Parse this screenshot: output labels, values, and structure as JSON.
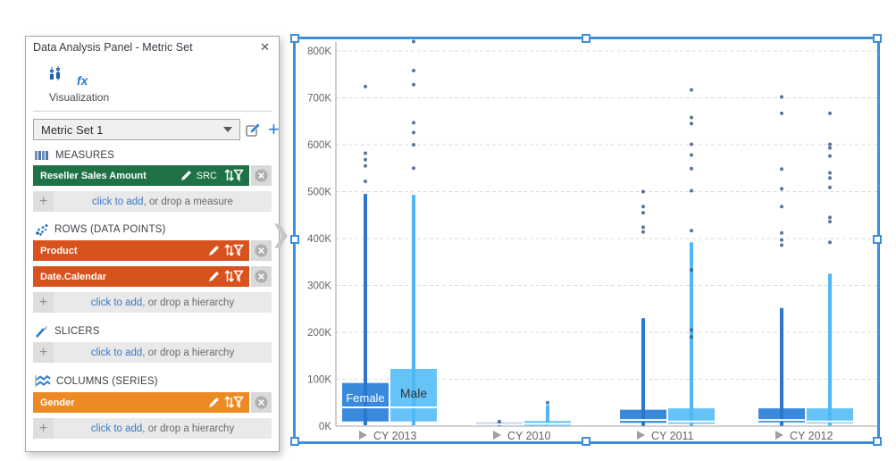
{
  "panel": {
    "title": "Data Analysis Panel - Metric Set",
    "visualization_label": "Visualization",
    "metric_set": {
      "selected": "Metric Set 1"
    },
    "sections": {
      "measures": {
        "label": "MEASURES",
        "items": [
          {
            "label": "Reseller Sales Amount",
            "badge": "SRC",
            "color": "#1E7245"
          }
        ],
        "add_link": "click to add",
        "add_rest": ", or drop a measure"
      },
      "rows": {
        "label": "ROWS (DATA POINTS)",
        "items": [
          {
            "label": "Product",
            "color": "#D8521D"
          },
          {
            "label": "Date.Calendar",
            "color": "#D8521D"
          }
        ],
        "add_link": "click to add",
        "add_rest": ", or drop a hierarchy"
      },
      "slicers": {
        "label": "SLICERS",
        "items": [],
        "add_link": "click to add",
        "add_rest": ", or drop a hierarchy"
      },
      "columns": {
        "label": "COLUMNS (SERIES)",
        "items": [
          {
            "label": "Gender",
            "color": "#EE8A24"
          }
        ],
        "add_link": "click to add",
        "add_rest": ", or drop a hierarchy"
      }
    }
  },
  "colors": {
    "selection": "#3E8EDE",
    "measure_green": "#1E7245",
    "row_orange_red": "#D8521D",
    "column_orange": "#EE8A24",
    "link_blue": "#3B78C8",
    "accent_blue": "#2B7CD3"
  },
  "chart_data": {
    "type": "boxplot",
    "title": "",
    "value_unit": "thousands (K)",
    "y_axis": {
      "min": 0,
      "max": 800,
      "tick_step": 100,
      "tick_labels": [
        "0K",
        "100K",
        "200K",
        "300K",
        "400K",
        "500K",
        "600K",
        "700K",
        "800K"
      ]
    },
    "categories": [
      "CY 2013",
      "CY 2010",
      "CY 2011",
      "CY 2012"
    ],
    "series_labels_on_category": 0,
    "outlier_color": "#3E5C8A",
    "series": [
      {
        "name": "Female",
        "color": "#3989DC",
        "whisker_color": "#2C77CE",
        "label_color": "#FFFFFF",
        "points": [
          {
            "low": 2,
            "q1": 10,
            "med": 40,
            "q3": 92,
            "high": 495,
            "outliers": [
              522,
              555,
              568,
              582,
              724
            ]
          },
          {
            "low": 1,
            "q1": 2,
            "med": 4,
            "q3": 7,
            "high": 8,
            "outliers": [
              10
            ]
          },
          {
            "low": 1,
            "q1": 7,
            "med": 13,
            "q3": 35,
            "high": 230,
            "outliers": [
              414,
              424,
              455,
              468,
              500
            ]
          },
          {
            "low": 1,
            "q1": 8,
            "med": 13,
            "q3": 38,
            "high": 252,
            "outliers": [
              386,
              397,
              412,
              468,
              506,
              548,
              667,
              702
            ]
          }
        ]
      },
      {
        "name": "Male",
        "color": "#66C3F7",
        "whisker_color": "#4DB8F4",
        "label_color": "#333333",
        "points": [
          {
            "low": 2,
            "q1": 10,
            "med": 40,
            "q3": 122,
            "high": 493,
            "outliers": [
              550,
              600,
              626,
              647,
              728,
              758,
              820
            ]
          },
          {
            "low": 1,
            "q1": 1,
            "med": 5,
            "q3": 11,
            "high": 45,
            "outliers": [
              50
            ]
          },
          {
            "low": 1,
            "q1": 5,
            "med": 10,
            "q3": 38,
            "high": 392,
            "outliers": [
              190,
              205,
              333,
              417,
              502,
              549,
              578,
              601,
              645,
              658,
              717
            ]
          },
          {
            "low": 1,
            "q1": 6,
            "med": 10,
            "q3": 38,
            "high": 325,
            "outliers": [
              392,
              436,
              445,
              509,
              529,
              540,
              576,
              593,
              601,
              667
            ]
          }
        ]
      }
    ]
  }
}
